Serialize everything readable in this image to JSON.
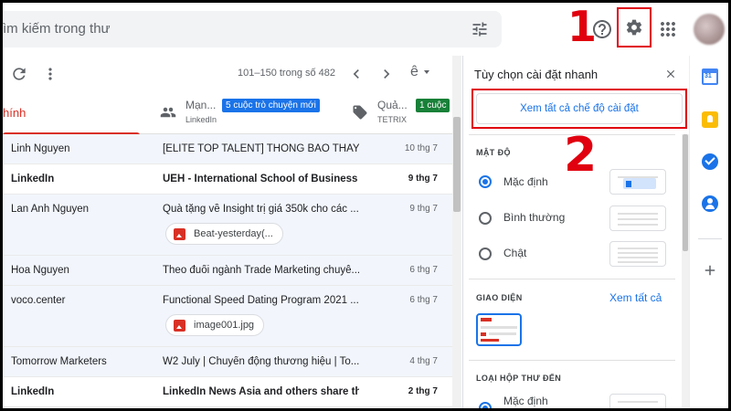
{
  "search": {
    "placeholder": "ìm kiếm trong thư"
  },
  "annotations": {
    "step1": "1",
    "step2": "2"
  },
  "toolbar": {
    "pager": "101–150 trong số 482",
    "lang_glyph": "ê"
  },
  "tabs": {
    "primary": {
      "label": "hính"
    },
    "social": {
      "name": "Mạn...",
      "badge": "5 cuộc trò chuyện mới",
      "sub": "LinkedIn"
    },
    "promotions": {
      "name": "Quả...",
      "badge": "1 cuộc",
      "sub": "TETRIX"
    }
  },
  "emails": [
    {
      "sender": "Linh Nguyen",
      "subject": "[ELITE TOP TALENT] THÔNG BÁO THAY...",
      "date": "10 thg 7",
      "unread": false
    },
    {
      "sender": "LinkedIn",
      "subject": "UEH - International School of Business ...",
      "date": "9 thg 7",
      "unread": true
    },
    {
      "sender": "Lan Anh Nguyen",
      "subject": "Quà tặng về Insight trị giá 350k cho các ...",
      "date": "9 thg 7",
      "unread": false,
      "attachment": "Beat-yesterday(..."
    },
    {
      "sender": "Hoa Nguyen",
      "subject": "Theo đuổi ngành Trade Marketing chuyê...",
      "date": "6 thg 7",
      "unread": false
    },
    {
      "sender": "voco.center",
      "subject": "Functional Speed Dating Program 2021 ...",
      "date": "6 thg 7",
      "unread": false,
      "attachment": "image001.jpg"
    },
    {
      "sender": "Tomorrow Marketers",
      "subject": "W2 July | Chuyển động thương hiệu | To...",
      "date": "4 thg 7",
      "unread": false
    },
    {
      "sender": "LinkedIn",
      "subject": "LinkedIn News Asia and others share th...",
      "date": "2 thg 7",
      "unread": true
    }
  ],
  "quick_settings": {
    "title": "Tùy chọn cài đặt nhanh",
    "see_all_settings": "Xem tất cả chế độ cài đặt",
    "density_heading": "MẬT ĐỘ",
    "density_options": [
      {
        "label": "Mặc định",
        "selected": true
      },
      {
        "label": "Bình thường",
        "selected": false
      },
      {
        "label": "Chật",
        "selected": false
      }
    ],
    "theme_heading": "GIAO DIỆN",
    "theme_see_all": "Xem tất cả",
    "inbox_heading": "LOẠI HỘP THƯ ĐẾN",
    "inbox_option": "Mặc định"
  },
  "icons": {
    "search_options": "tune-icon",
    "help": "help-icon",
    "settings": "gear-icon",
    "apps": "apps-grid-icon",
    "rail": [
      "google-calendar-icon",
      "google-keep-icon",
      "google-tasks-icon",
      "google-contacts-icon",
      "add-icon"
    ]
  },
  "colors": {
    "accent": "#1a73e8",
    "primary_tab": "#d93025",
    "annotation": "#e0000f",
    "promo_badge": "#188038"
  }
}
